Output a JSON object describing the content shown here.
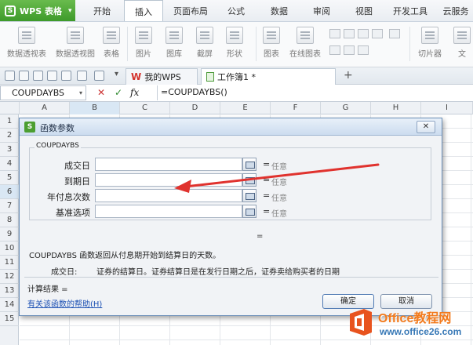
{
  "app": {
    "name": "WPS 表格"
  },
  "tabs": [
    "开始",
    "插入",
    "页面布局",
    "公式",
    "数据",
    "审阅",
    "视图",
    "开发工具",
    "云服务"
  ],
  "active_tab": "插入",
  "ribbon": {
    "buttons": [
      "数据透视表",
      "数据透视图",
      "表格",
      "图片",
      "图库",
      "截屏",
      "形状",
      "图表",
      "在线图表",
      "切片器",
      "文"
    ]
  },
  "doc_tabs": [
    {
      "label": "我的WPS"
    },
    {
      "label": "工作簿1 *"
    }
  ],
  "formula_bar": {
    "name_box": "COUPDAYBS",
    "cancel_glyph": "✕",
    "confirm_glyph": "✓",
    "fx_label": "fx",
    "formula": "=COUPDAYBS()"
  },
  "grid": {
    "columns": [
      "A",
      "B",
      "C",
      "D",
      "E",
      "F",
      "G",
      "H",
      "I"
    ],
    "rows": [
      "1",
      "2",
      "3",
      "4",
      "5",
      "6",
      "7",
      "8",
      "9",
      "10",
      "11",
      "12",
      "13",
      "14",
      "15"
    ],
    "selected_column": "B",
    "selected_row": "6"
  },
  "dialog": {
    "title": "函数参数",
    "close": "✕",
    "group_label": "COUPDAYBS",
    "args": [
      {
        "label": "成交日",
        "eq": "=",
        "value": "任意"
      },
      {
        "label": "到期日",
        "eq": "=",
        "value": "任意"
      },
      {
        "label": "年付息次数",
        "eq": "=",
        "value": "任意"
      },
      {
        "label": "基准选项",
        "eq": "=",
        "value": "任意"
      }
    ],
    "result_eq": "=",
    "description": "COUPDAYBS 函数返回从付息期开始到结算日的天数。",
    "arg_name": "成交日:",
    "arg_description": "证券的结算日。证券结算日是在发行日期之后，证券卖给购买者的日期",
    "calc_result": "计算结果 =",
    "help_link": "有关该函数的帮助(H)",
    "ok": "确定",
    "cancel": "取消"
  },
  "watermark": {
    "brand": "Office教程网",
    "url": "www.office26.com"
  },
  "colors": {
    "accent_green": "#4b9e31",
    "annotation_arrow": "#e0322e",
    "watermark_orange": "#f27a1c"
  }
}
